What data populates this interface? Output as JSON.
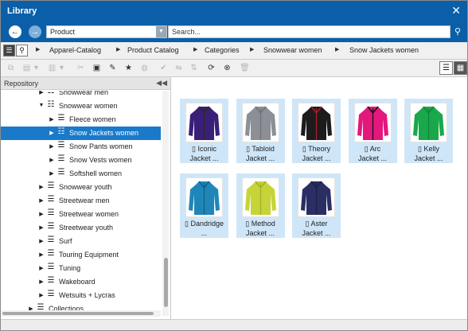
{
  "window": {
    "title": "Library"
  },
  "searchbar": {
    "scope": "Product",
    "search_placeholder": "Search..."
  },
  "breadcrumb": [
    "Apparel-Catalog",
    "Product Catalog",
    "Categories",
    "Snowwear women",
    "Snow Jackets women"
  ],
  "sidebar": {
    "title": "Repository",
    "tree": [
      {
        "label": "Snowwear men",
        "level": 2,
        "expanded": false,
        "type": "category-alt"
      },
      {
        "label": "Snowwear women",
        "level": 2,
        "expanded": true,
        "type": "category-alt"
      },
      {
        "label": "Fleece women",
        "level": 3,
        "expanded": false,
        "type": "category"
      },
      {
        "label": "Snow Jackets women",
        "level": 3,
        "expanded": false,
        "type": "category-alt",
        "selected": true
      },
      {
        "label": "Snow Pants women",
        "level": 3,
        "expanded": false,
        "type": "category"
      },
      {
        "label": "Snow Vests women",
        "level": 3,
        "expanded": false,
        "type": "category"
      },
      {
        "label": "Softshell women",
        "level": 3,
        "expanded": false,
        "type": "category"
      },
      {
        "label": "Snowwear youth",
        "level": 2,
        "expanded": false,
        "type": "category"
      },
      {
        "label": "Streetwear men",
        "level": 2,
        "expanded": false,
        "type": "category"
      },
      {
        "label": "Streetwear women",
        "level": 2,
        "expanded": false,
        "type": "category"
      },
      {
        "label": "Streetwear youth",
        "level": 2,
        "expanded": false,
        "type": "category"
      },
      {
        "label": "Surf",
        "level": 2,
        "expanded": false,
        "type": "category"
      },
      {
        "label": "Touring Equipment",
        "level": 2,
        "expanded": false,
        "type": "category"
      },
      {
        "label": "Tuning",
        "level": 2,
        "expanded": false,
        "type": "category"
      },
      {
        "label": "Wakeboard",
        "level": 2,
        "expanded": false,
        "type": "category"
      },
      {
        "label": "Wetsuits + Lycras",
        "level": 2,
        "expanded": false,
        "type": "category"
      },
      {
        "label": "Collections",
        "level": 1,
        "expanded": false,
        "type": "category"
      }
    ]
  },
  "products": [
    {
      "name": "Iconic\nJacket ...",
      "color": "#3a1f78",
      "accent": "#2a2a2a"
    },
    {
      "name": "Tabloid\nJacket ...",
      "color": "#8c8f96",
      "accent": "#6e7178"
    },
    {
      "name": "Theory\nJacket ...",
      "color": "#1c1c1c",
      "accent": "#b01c2a"
    },
    {
      "name": "Arc\nJacket ...",
      "color": "#e4177d",
      "accent": "#111111"
    },
    {
      "name": "Kelly\nJacket ...",
      "color": "#19a84a",
      "accent": "#12823a"
    },
    {
      "name": "Dandridge ...",
      "color": "#1f86b8",
      "accent": "#145f86"
    },
    {
      "name": "Method\nJacket ...",
      "color": "#c6d438",
      "accent": "#a2af2a"
    },
    {
      "name": "Aster\nJacket ...",
      "color": "#2a2e63",
      "accent": "#1d2047"
    }
  ]
}
